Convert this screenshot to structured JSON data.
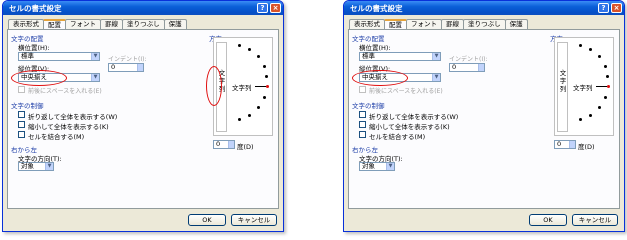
{
  "dialogs": [
    {
      "title": "セルの書式設定",
      "help_label": "?",
      "close_label": "×",
      "tabs": [
        "表示形式",
        "配置",
        "フォント",
        "罫線",
        "塗りつぶし",
        "保護"
      ],
      "active_tab": "配置",
      "alignment_section": "文字の配置",
      "horizontal_label": "横位置(H):",
      "horizontal_value": "標準",
      "indent_label": "インデント(I):",
      "indent_value": "0",
      "vertical_label": "縦位置(V):",
      "vertical_value": "中央揃え",
      "distributed_label": "前後にスペースを入れる(E)",
      "control_section": "文字の制御",
      "checkboxes": [
        "折り返して全体を表示する(W)",
        "縮小して全体を表示する(K)",
        "セルを結合する(M)"
      ],
      "rtl_section": "右から左",
      "direction_label": "文字の方向(T):",
      "direction_value": "対象",
      "orientation_section": "方向",
      "vertical_text": "文字列",
      "horizontal_text": "文字列",
      "degree_value": "0",
      "degree_label": "度(D)",
      "ok_label": "OK",
      "cancel_label": "キャンセル",
      "highlight": "vertical"
    },
    {
      "title": "セルの書式設定",
      "help_label": "?",
      "close_label": "×",
      "tabs": [
        "表示形式",
        "配置",
        "フォント",
        "罫線",
        "塗りつぶし",
        "保護"
      ],
      "active_tab": "配置",
      "alignment_section": "文字の配置",
      "horizontal_label": "横位置(H):",
      "horizontal_value": "標準",
      "indent_label": "インデント(I):",
      "indent_value": "0",
      "vertical_label": "縦位置(V):",
      "vertical_value": "中央揃え",
      "distributed_label": "前後にスペースを入れる(E)",
      "control_section": "文字の制御",
      "checkboxes": [
        "折り返して全体を表示する(W)",
        "縮小して全体を表示する(K)",
        "セルを結合する(M)"
      ],
      "rtl_section": "右から左",
      "direction_label": "文字の方向(T):",
      "direction_value": "対象",
      "orientation_section": "方向",
      "vertical_text": "文字列",
      "horizontal_text": "文字列",
      "degree_value": "0",
      "degree_label": "度(D)",
      "ok_label": "OK",
      "cancel_label": "キャンセル",
      "highlight": "horizontal"
    }
  ],
  "colors": {
    "titlebar": "#0a5fd8",
    "dialog_bg": "#ece9d8",
    "section_text": "#1f3fa8",
    "highlight": "#e01010"
  }
}
